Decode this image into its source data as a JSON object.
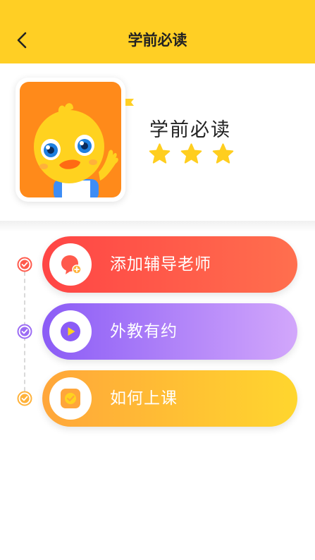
{
  "header": {
    "title": "学前必读",
    "back_icon": "chevron-left-icon"
  },
  "profile": {
    "title": "学前必读",
    "stars": 3
  },
  "menu": [
    {
      "label": "添加辅导老师",
      "icon": "chat-bubble-icon"
    },
    {
      "label": "外教有约",
      "icon": "play-icon"
    },
    {
      "label": "如何上课",
      "icon": "check-box-icon"
    }
  ],
  "colors": {
    "header": "#FFCF24",
    "tutor": "#FF4545",
    "foreign": "#8B5CF6",
    "howto": "#FFA63A"
  }
}
